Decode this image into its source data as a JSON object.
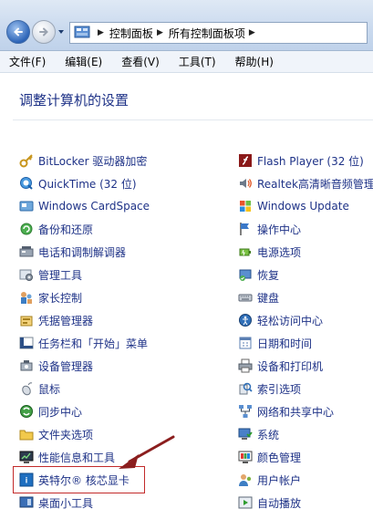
{
  "breadcrumb": {
    "items": [
      "控制面板",
      "所有控制面板项"
    ],
    "separator": "▶"
  },
  "menu": {
    "items": [
      "文件(F)",
      "编辑(E)",
      "查看(V)",
      "工具(T)",
      "帮助(H)"
    ]
  },
  "page": {
    "heading": "调整计算机的设置"
  },
  "left_items": [
    {
      "label": "BitLocker 驱动器加密",
      "icon": "bitlocker-key-icon"
    },
    {
      "label": "QuickTime (32 位)",
      "icon": "quicktime-icon"
    },
    {
      "label": "Windows CardSpace",
      "icon": "cardspace-icon"
    },
    {
      "label": "备份和还原",
      "icon": "backup-icon"
    },
    {
      "label": "电话和调制解调器",
      "icon": "phone-modem-icon"
    },
    {
      "label": "管理工具",
      "icon": "admin-tools-icon"
    },
    {
      "label": "家长控制",
      "icon": "parental-controls-icon"
    },
    {
      "label": "凭据管理器",
      "icon": "credential-manager-icon"
    },
    {
      "label": "任务栏和「开始」菜单",
      "icon": "taskbar-icon"
    },
    {
      "label": "设备管理器",
      "icon": "device-manager-icon"
    },
    {
      "label": "鼠标",
      "icon": "mouse-icon"
    },
    {
      "label": "同步中心",
      "icon": "sync-center-icon"
    },
    {
      "label": "文件夹选项",
      "icon": "folder-options-icon"
    },
    {
      "label": "性能信息和工具",
      "icon": "performance-icon"
    },
    {
      "label": "英特尔® 核芯显卡",
      "icon": "intel-graphics-icon"
    },
    {
      "label": "桌面小工具",
      "icon": "gadgets-icon"
    }
  ],
  "right_items": [
    {
      "label": "Flash Player (32 位)",
      "icon": "flash-player-icon"
    },
    {
      "label": "Realtek高清晰音频管理",
      "icon": "realtek-audio-icon"
    },
    {
      "label": "Windows Update",
      "icon": "windows-update-icon"
    },
    {
      "label": "操作中心",
      "icon": "action-center-flag-icon"
    },
    {
      "label": "电源选项",
      "icon": "power-options-icon"
    },
    {
      "label": "恢复",
      "icon": "recovery-icon"
    },
    {
      "label": "键盘",
      "icon": "keyboard-icon"
    },
    {
      "label": "轻松访问中心",
      "icon": "ease-of-access-icon"
    },
    {
      "label": "日期和时间",
      "icon": "date-time-icon"
    },
    {
      "label": "设备和打印机",
      "icon": "printer-icon"
    },
    {
      "label": "索引选项",
      "icon": "indexing-icon"
    },
    {
      "label": "网络和共享中心",
      "icon": "network-icon"
    },
    {
      "label": "系统",
      "icon": "system-icon"
    },
    {
      "label": "颜色管理",
      "icon": "color-management-icon"
    },
    {
      "label": "用户帐户",
      "icon": "user-accounts-icon"
    },
    {
      "label": "自动播放",
      "icon": "autoplay-icon"
    }
  ],
  "annotation": {
    "highlight_color": "#c22a2a",
    "highlighted_item": "英特尔® 核芯显卡"
  },
  "colors": {
    "link": "#1e3287",
    "heading": "#1e3287"
  }
}
